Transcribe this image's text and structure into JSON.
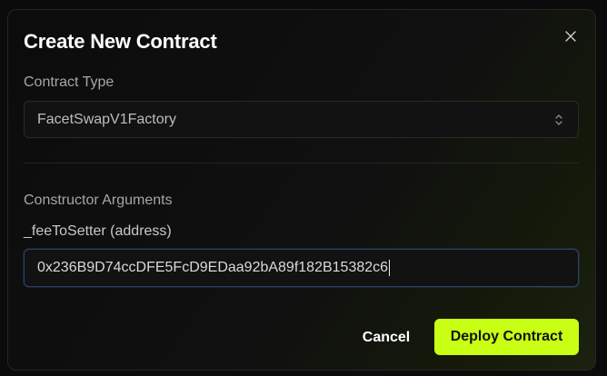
{
  "modal": {
    "title": "Create New Contract",
    "close_icon": "close-icon",
    "contract_type": {
      "label": "Contract Type",
      "selected": "FacetSwapV1Factory",
      "icon": "chevron-up-down-icon"
    },
    "constructor": {
      "label": "Constructor Arguments",
      "args": [
        {
          "label": "_feeToSetter (address)",
          "value": "0x236B9D74ccDFE5FcD9EDaa92bA89f182B15382c6"
        }
      ]
    },
    "actions": {
      "cancel_label": "Cancel",
      "deploy_label": "Deploy Contract"
    },
    "colors": {
      "accent": "#c9ff14",
      "focus_border": "#2d3f66"
    }
  }
}
